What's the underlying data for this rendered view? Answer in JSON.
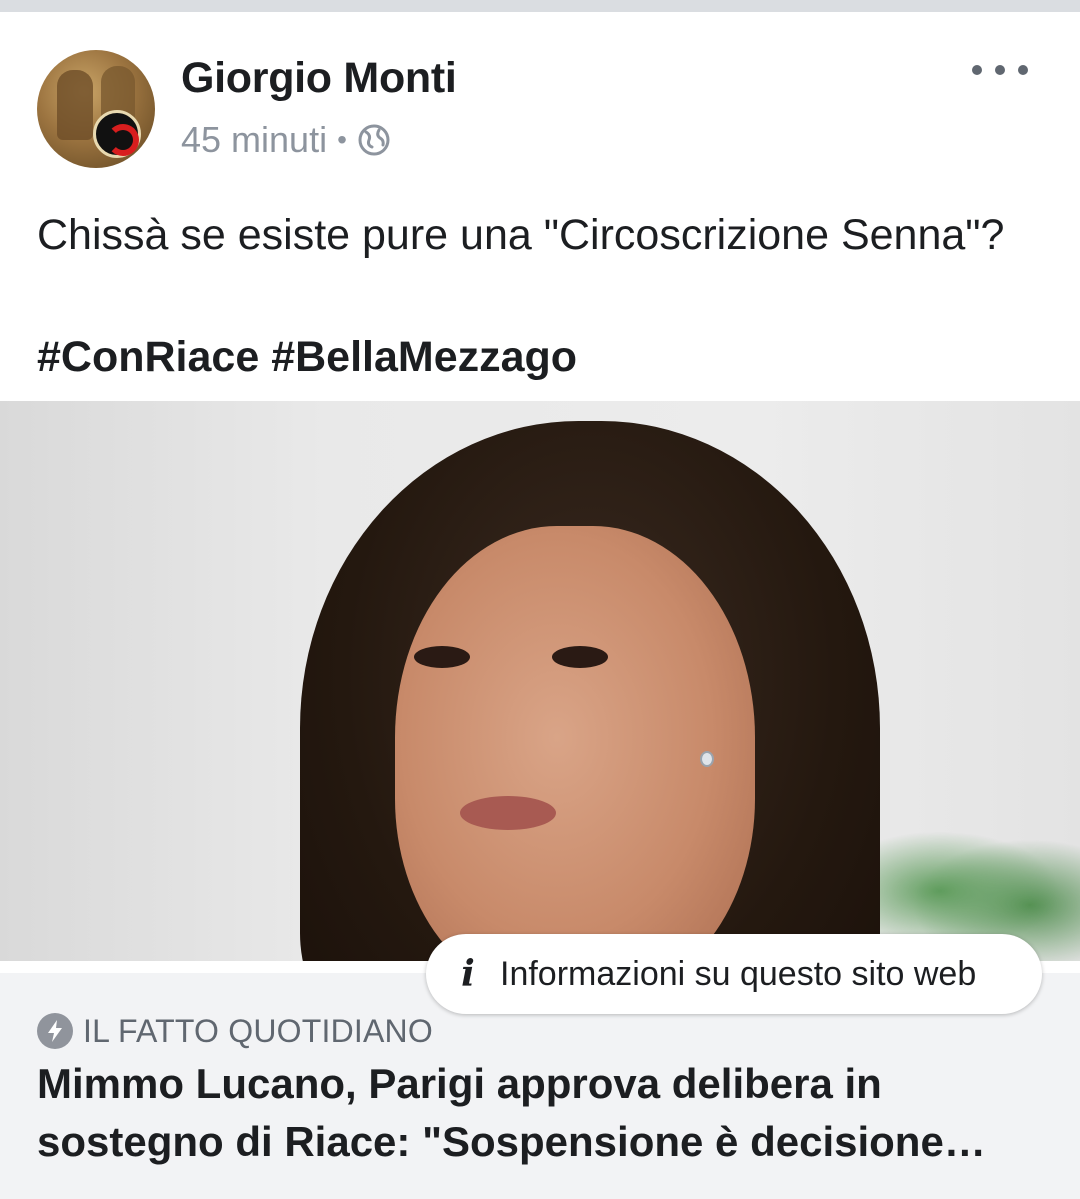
{
  "post": {
    "author": "Giorgio Monti",
    "time": "45 minuti",
    "separator": "•",
    "privacy_icon": "globe-icon",
    "more_icon": "ellipsis-icon",
    "text": "Chissà se esiste pure una \"Circoscrizione Senna\"?",
    "hashtags": "#ConRiace #BellaMezzago"
  },
  "link": {
    "info_label": "Informazioni su questo sito web",
    "source": "IL FATTO QUOTIDIANO",
    "headline": "Mimmo Lucano, Parigi approva delibera in sostegno di Riace: \"Sospensione è decisione…"
  },
  "colors": {
    "text_primary": "#1c1e21",
    "text_secondary": "#8d949e",
    "footer_bg": "#f2f3f5"
  }
}
